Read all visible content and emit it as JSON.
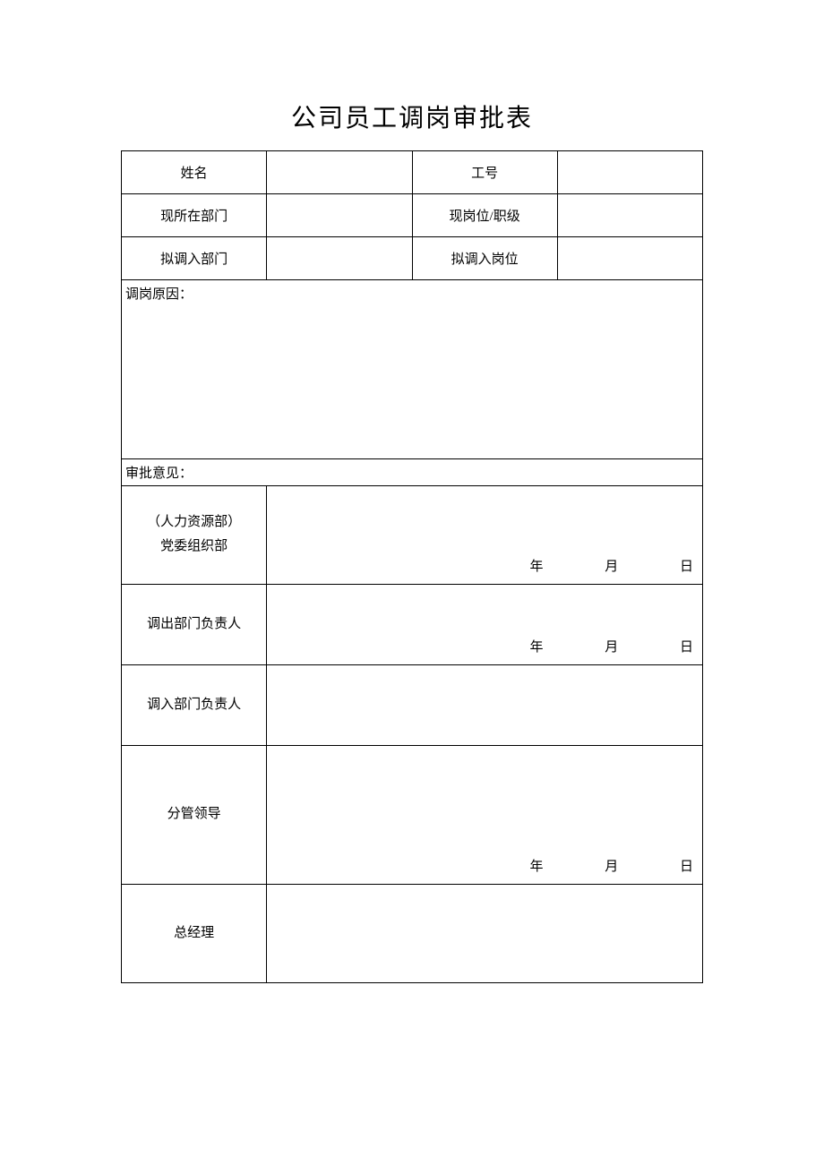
{
  "title": "公司员工调岗审批表",
  "fields": {
    "name_label": "姓名",
    "name_value": "",
    "id_label": "工号",
    "id_value": "",
    "current_dept_label": "现所在部门",
    "current_dept_value": "",
    "current_pos_label": "现岗位/职级",
    "current_pos_value": "",
    "target_dept_label": "拟调入部门",
    "target_dept_value": "",
    "target_pos_label": "拟调入岗位",
    "target_pos_value": ""
  },
  "reason": {
    "label": "调岗原因：",
    "value": ""
  },
  "approval": {
    "label": "审批意见：",
    "hr_label_line1": "（人力资源部）",
    "hr_label_line2": "党委组织部",
    "out_dept_label": "调出部门负责人",
    "in_dept_label": "调入部门负责人",
    "leader_label": "分管领导",
    "gm_label": "总经理"
  },
  "date": {
    "year": "年",
    "month": "月",
    "day": "日"
  }
}
